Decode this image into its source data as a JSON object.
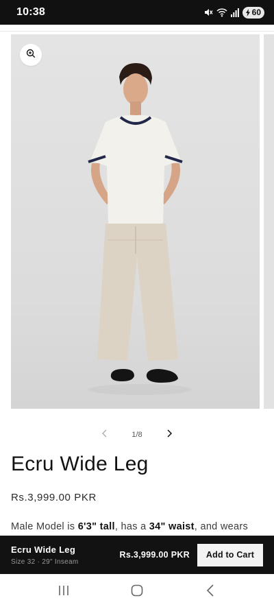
{
  "status_bar": {
    "time": "10:38",
    "battery": "60",
    "icons": [
      "mute-icon",
      "wifi-icon",
      "signal-icon",
      "battery-icon"
    ]
  },
  "gallery": {
    "current": "1/8",
    "zoom_icon": "zoom-in-icon",
    "prev_icon": "chevron-left-icon",
    "next_icon": "chevron-right-icon"
  },
  "product": {
    "title": "Ecru Wide Leg",
    "price": "Rs.3,999.00 PKR",
    "desc_prefix": "Male Model is ",
    "desc_height": "6'3\" tall",
    "desc_mid": ", has a ",
    "desc_waist": "34\" waist",
    "desc_suffix": ", and wears"
  },
  "cart_bar": {
    "name": "Ecru Wide Leg",
    "variant": "Size 32 · 29\" Inseam",
    "price": "Rs.3,999.00 PKR",
    "button_label": "Add to Cart"
  },
  "nav": {
    "icons": [
      "recents-icon",
      "home-icon",
      "back-icon"
    ]
  },
  "colors": {
    "accent": "#121212",
    "image_bg": "#e0e0e0",
    "button_bg": "#f3f3f3"
  }
}
